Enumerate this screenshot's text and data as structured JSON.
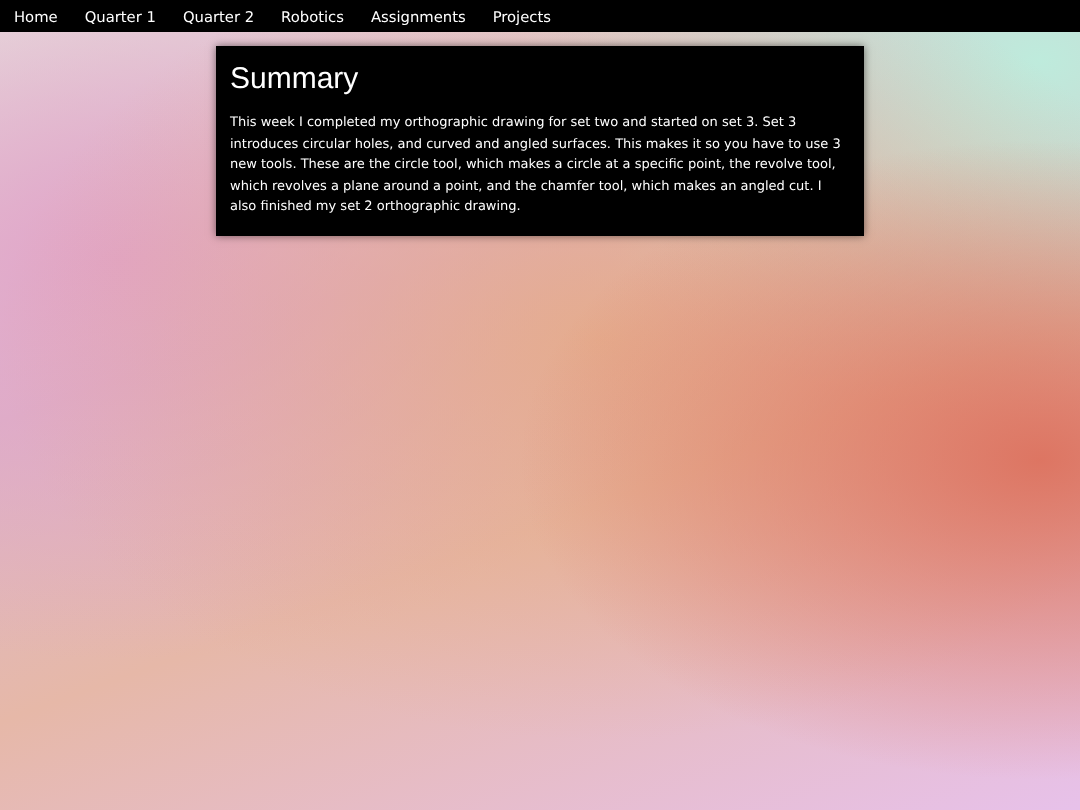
{
  "nav": {
    "items": [
      {
        "label": "Home"
      },
      {
        "label": "Quarter 1"
      },
      {
        "label": "Quarter 2"
      },
      {
        "label": "Robotics"
      },
      {
        "label": "Assignments"
      },
      {
        "label": "Projects"
      }
    ]
  },
  "summary": {
    "title": "Summary",
    "text": "This week I completed my orthographic drawing for set two and started on set 3. Set 3 introduces circular holes, and curved and angled surfaces. This makes it so you have to use 3 new tools. These are the circle tool, which makes a circle at a specific point, the revolve tool, which revolves a plane around a point, and the chamfer tool, which makes an angled cut. I also finished my set 2 orthographic drawing."
  }
}
